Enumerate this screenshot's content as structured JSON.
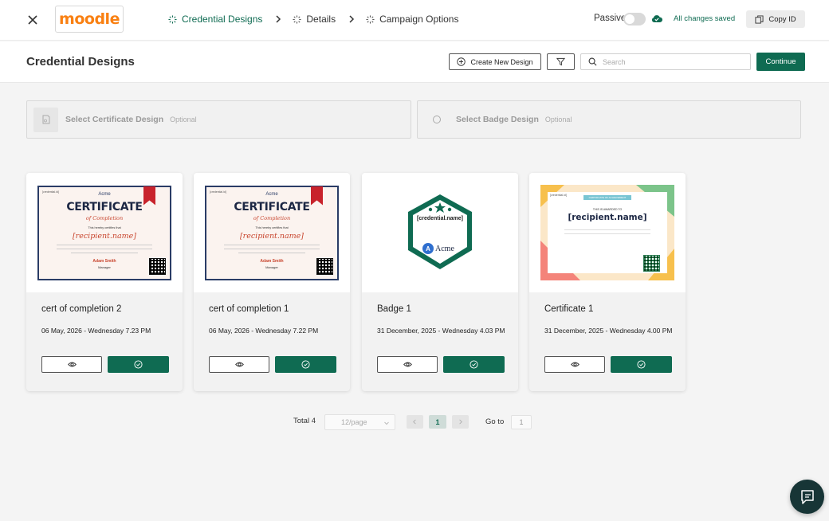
{
  "topbar": {
    "logo_text": "moodle",
    "steps": [
      {
        "label": "Credential Designs",
        "active": true
      },
      {
        "label": "Details",
        "active": false
      },
      {
        "label": "Campaign Options",
        "active": false
      }
    ],
    "passive_label": "Passive",
    "passive_on": false,
    "save_status": "All changes saved",
    "copy_id_label": "Copy ID"
  },
  "header": {
    "title": "Credential Designs",
    "create_label": "Create New Design",
    "search_placeholder": "Search",
    "continue_label": "Continue"
  },
  "slots": {
    "certificate": {
      "label": "Select Certificate Design",
      "optional": "Optional"
    },
    "badge": {
      "label": "Select Badge Design",
      "optional": "Optional"
    }
  },
  "cards": [
    {
      "title": "cert of completion 2",
      "date": "06 May, 2026 - Wednesday 7.23 PM",
      "kind": "certificate"
    },
    {
      "title": "cert of completion 1",
      "date": "06 May, 2026 - Wednesday 7.22 PM",
      "kind": "certificate"
    },
    {
      "title": "Badge 1",
      "date": "31 December, 2025 - Wednesday 4.03 PM",
      "kind": "badge"
    },
    {
      "title": "Certificate 1",
      "date": "31 December, 2025 - Wednesday 4.00 PM",
      "kind": "certificate-colorful"
    }
  ],
  "thumbs": {
    "cert": {
      "tag": "[credential.id]",
      "org": "Acme",
      "title": "CERTIFICATE",
      "subtitle": "of Completion",
      "hereby": "This hereby certifies that",
      "recipient": "[recipient.name]",
      "signer": "Adam Smith",
      "signer_role": "Manager"
    },
    "badge": {
      "name": "[credential.name]",
      "org": "Acme"
    },
    "cert_colorful": {
      "tag": "[credential.id]",
      "banner": "CERTIFICATE OF ACHIEVEMENT",
      "award": "THIS IS AWARDED TO",
      "recipient": "[recipient.name]"
    }
  },
  "pagination": {
    "total_label": "Total 4",
    "page_size": "12/page",
    "current_page": "1",
    "goto_label": "Go to",
    "goto_value": "1"
  },
  "colors": {
    "brand_green": "#0f6b52",
    "moodle_orange": "#f98012",
    "chat_fab": "#173536"
  }
}
